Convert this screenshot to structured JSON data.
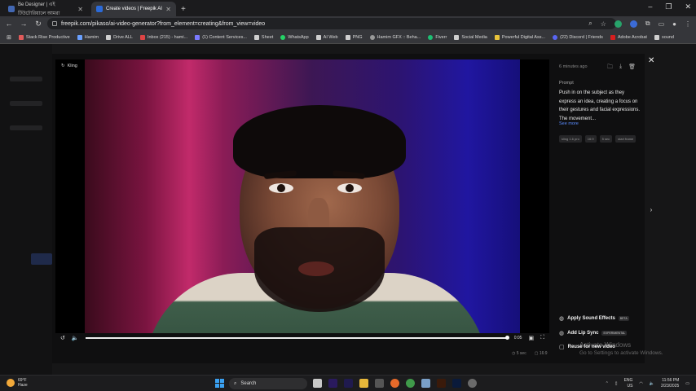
{
  "browser": {
    "tabs": [
      {
        "title": "Be Designer | এই টিউটোরিয়ালে আমরা",
        "active": false,
        "color": "#4267b2"
      },
      {
        "title": "Create videos | Freepik AI",
        "active": true,
        "color": "#2b6ad8"
      }
    ],
    "new_tab": "+",
    "url": "freepik.com/pikaso/ai-video-generator?from_element=creating&from_view=video",
    "bookmarks": [
      "Stack Rise Productive",
      "Hamim",
      "Drive ALL",
      "Inbox (215) - hami...",
      "(1) Content Services...",
      "Sheet",
      "WhatsApp",
      "AI Web",
      "PNG",
      "Hamim GFX :: Beha...",
      "Fiverr",
      "Social Media",
      "Powerful Digital Ass...",
      "(22) Discord | Friends",
      "Adobe Acrobat",
      "sound"
    ]
  },
  "video": {
    "model_label": "Kling",
    "current_time": "0:05"
  },
  "video_meta": {
    "duration": "5 sec",
    "ratio": "16:9"
  },
  "panel": {
    "timestamp": "6 minutes ago",
    "prompt_heading": "Prompt",
    "prompt_text": "Push in on the subject as they express an idea, creating a focus on their gestures and facial expressions. The movement...",
    "see_more": "See more",
    "tags": [
      "kling 1.6 pro",
      "16:9",
      "5 sec",
      "start frame"
    ],
    "actions": [
      {
        "label": "Apply Sound Effects",
        "badge": "BETA"
      },
      {
        "label": "Add Lip Sync",
        "badge": "EXPERIMENTAL"
      },
      {
        "label": "Reuse for new video",
        "badge": ""
      }
    ]
  },
  "watermark": {
    "line1": "Activate Windows",
    "line2": "Go to Settings to activate Windows."
  },
  "taskbar": {
    "weather_temp": "69°F",
    "weather_desc": "Haze",
    "search_placeholder": "Search",
    "lang": "ENG",
    "region": "US",
    "time": "11:56 PM",
    "date": "2/23/2025"
  },
  "colors": {
    "accent_link": "#5a8cff",
    "windows_blue": "#3aa0f0"
  }
}
